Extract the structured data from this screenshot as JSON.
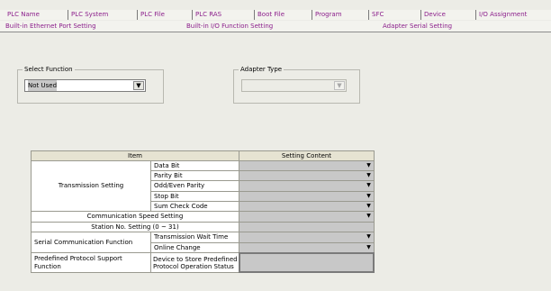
{
  "tabs_row1": [
    "PLC Name",
    "PLC System",
    "PLC File",
    "PLC RAS",
    "Boot File",
    "Program",
    "SFC",
    "Device",
    "I/O Assignment"
  ],
  "tabs_row2": [
    "Built-in Ethernet Port Setting",
    "Built-in I/O Function Setting",
    "Adapter Serial Setting"
  ],
  "select_function": {
    "label": "Select Function",
    "value": "Not Used"
  },
  "adapter_type": {
    "label": "Adapter Type",
    "value": ""
  },
  "table": {
    "headers": {
      "item": "Item",
      "setting": "Setting Content"
    },
    "transmission_setting": {
      "label": "Transmission Setting",
      "rows": [
        "Data Bit",
        "Parity Bit",
        "Odd/Even Parity",
        "Stop Bit",
        "Sum Check Code"
      ]
    },
    "communication_speed": "Communication Speed Setting",
    "station_no": "Station No. Setting (0 ~ 31)",
    "serial_communication": {
      "label": "Serial Communication Function",
      "rows": [
        "Transmission Wait Time",
        "Online Change"
      ]
    },
    "predefined_protocol": {
      "label": "Predefined Protocol Support Function",
      "row": "Device to Store Predefined Protocol Operation Status"
    },
    "dropdown_arrow": "▼"
  }
}
